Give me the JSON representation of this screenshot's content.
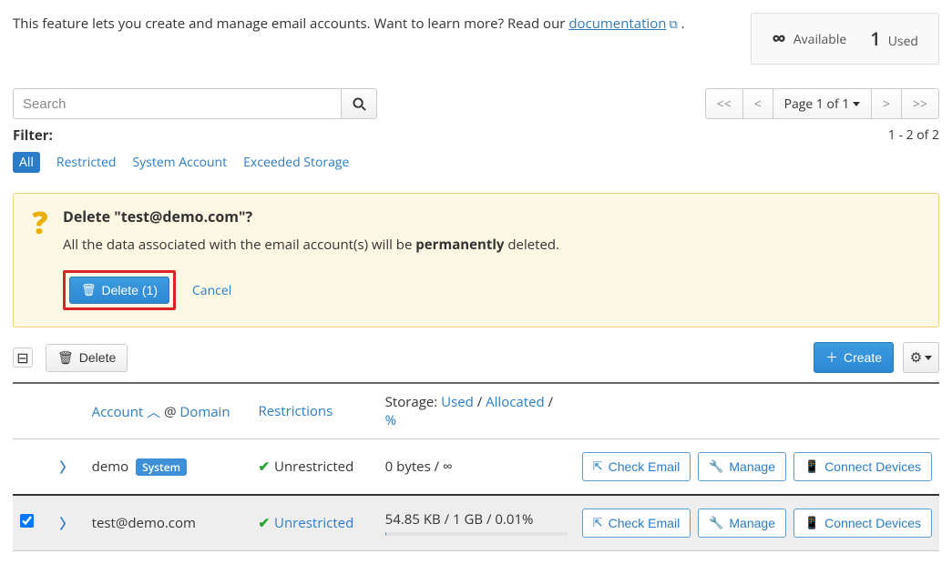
{
  "intro": {
    "text_before": "This feature lets you create and manage email accounts. Want to learn more? Read our ",
    "link_text": "documentation",
    "text_after": " ."
  },
  "quota": {
    "available": {
      "value": "∞",
      "label": "Available"
    },
    "used": {
      "value": "1",
      "label": "Used"
    }
  },
  "search": {
    "placeholder": "Search"
  },
  "pager": {
    "first": "<<",
    "prev": "<",
    "page": "Page 1 of 1",
    "next": ">",
    "last": ">>"
  },
  "range": "1 - 2 of 2",
  "filter": {
    "label": "Filter:",
    "items": [
      "All",
      "Restricted",
      "System Account",
      "Exceeded Storage"
    ]
  },
  "modal": {
    "title": "Delete \"test@demo.com\"?",
    "body_before": "All the data associated with the email account(s) will be ",
    "body_strong": "permanently",
    "body_after": " deleted.",
    "delete_btn": "Delete (1)",
    "cancel": "Cancel"
  },
  "bulk": {
    "delete": "Delete",
    "create": "Create"
  },
  "header": {
    "account": "Account",
    "domain": "Domain",
    "restrictions": "Restrictions",
    "storage_label": "Storage:",
    "used": "Used",
    "allocated": "Allocated",
    "percent": "%"
  },
  "rows": [
    {
      "account": "demo",
      "system_badge": "System",
      "restriction": "Unrestricted",
      "restriction_link": false,
      "storage": "0 bytes / ∞",
      "storage_bar": false,
      "selected": false
    },
    {
      "account": "test@demo.com",
      "system_badge": "",
      "restriction": "Unrestricted",
      "restriction_link": true,
      "storage": "54.85 KB / 1 GB / 0.01%",
      "storage_bar": true,
      "selected": true
    }
  ],
  "row_btn": {
    "check": "Check Email",
    "manage": "Manage",
    "devices": "Connect Devices"
  }
}
